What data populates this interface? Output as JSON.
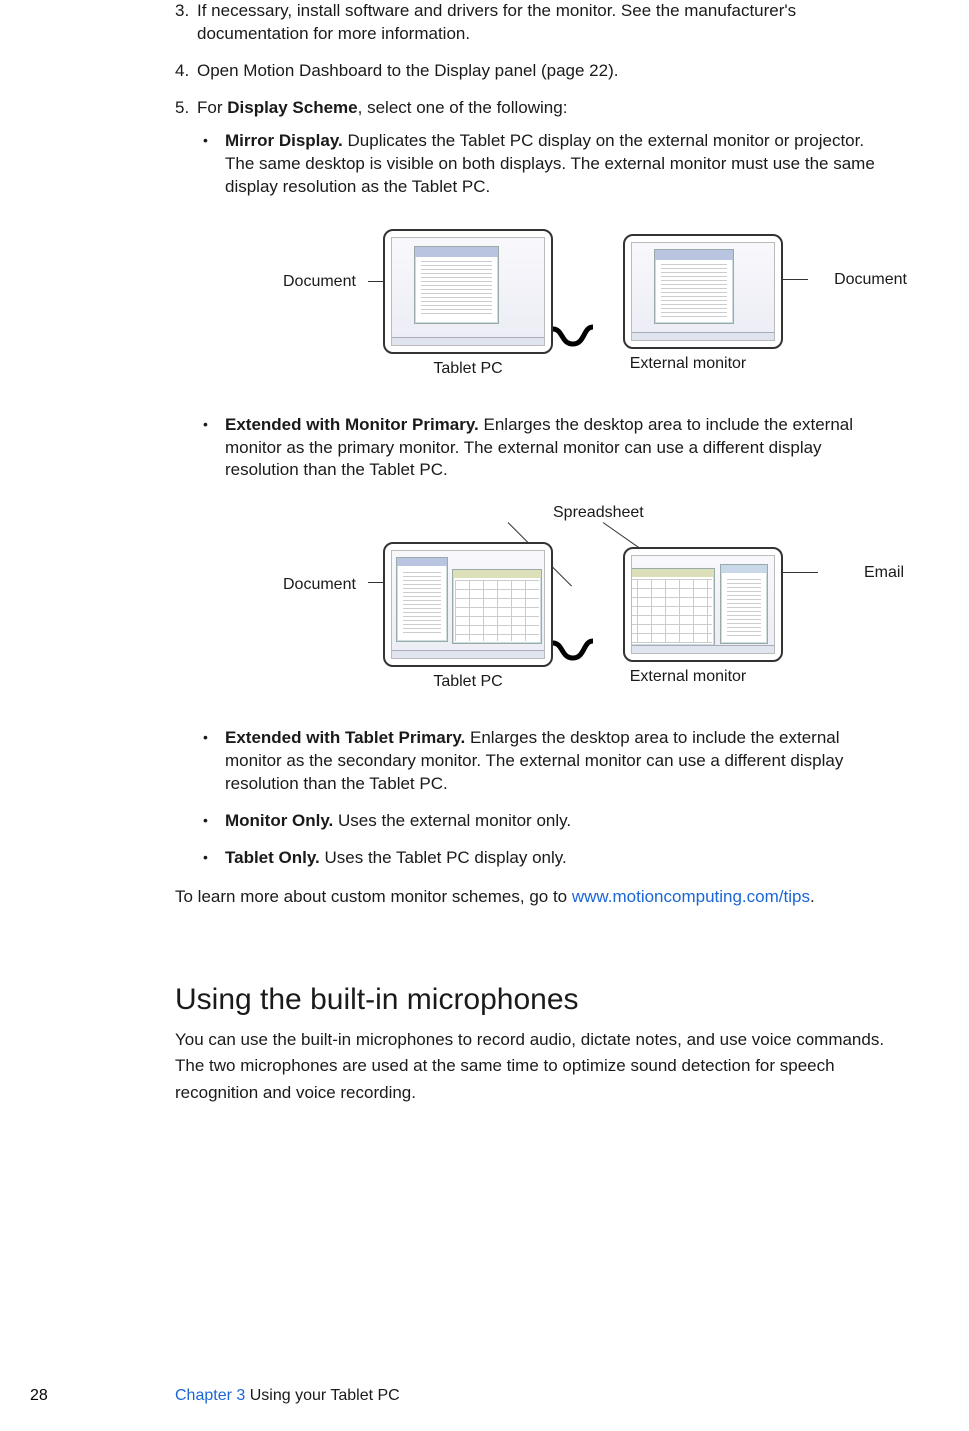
{
  "steps": {
    "s3": {
      "num": "3.",
      "text": "If necessary, install software and drivers for the monitor. See the manufacturer's documentation for more information."
    },
    "s4": {
      "num": "4.",
      "text": "Open Motion Dashboard to the Display panel (page 22)."
    },
    "s5": {
      "num": "5.",
      "prefix": "For ",
      "bold": "Display Scheme",
      "suffix": ", select one of the following:"
    }
  },
  "bullets": {
    "mirror": {
      "title": "Mirror Display.",
      "text": " Duplicates the Tablet PC display on the external monitor or projector. The same desktop is visible on both displays. The external monitor must use the same display resolution as the Tablet PC."
    },
    "extMon": {
      "title": "Extended with Monitor Primary.",
      "text": " Enlarges the desktop area to include the external monitor as the primary monitor. The external monitor can use a different display resolution than the Tablet PC."
    },
    "extTab": {
      "title": "Extended with Tablet Primary.",
      "text": " Enlarges the desktop area to include the external monitor as the secondary monitor. The external monitor can use a different display resolution than the Tablet PC."
    },
    "monOnly": {
      "title": "Monitor Only.",
      "text": " Uses the external monitor only."
    },
    "tabOnly": {
      "title": "Tablet Only.",
      "text": " Uses the Tablet PC display only."
    }
  },
  "fig1": {
    "doc_left": "Document",
    "doc_right": "Document",
    "tablet": "Tablet PC",
    "external": "External monitor"
  },
  "fig2": {
    "spreadsheet": "Spreadsheet",
    "document": "Document",
    "email": "Email",
    "tablet": "Tablet PC",
    "external": "External monitor"
  },
  "learn": {
    "prefix": "To learn more about custom monitor schemes, go to ",
    "link": "www.motioncomputing.com/tips",
    "suffix": "."
  },
  "mic": {
    "heading": "Using the built-in microphones",
    "body": "You can use the built-in microphones to record audio, dictate notes, and use voice commands. The two microphones are used at the same time to optimize sound detection for speech recognition and voice recording."
  },
  "footer": {
    "page": "28",
    "chapter": "Chapter 3",
    "title": "  Using your Tablet PC"
  }
}
